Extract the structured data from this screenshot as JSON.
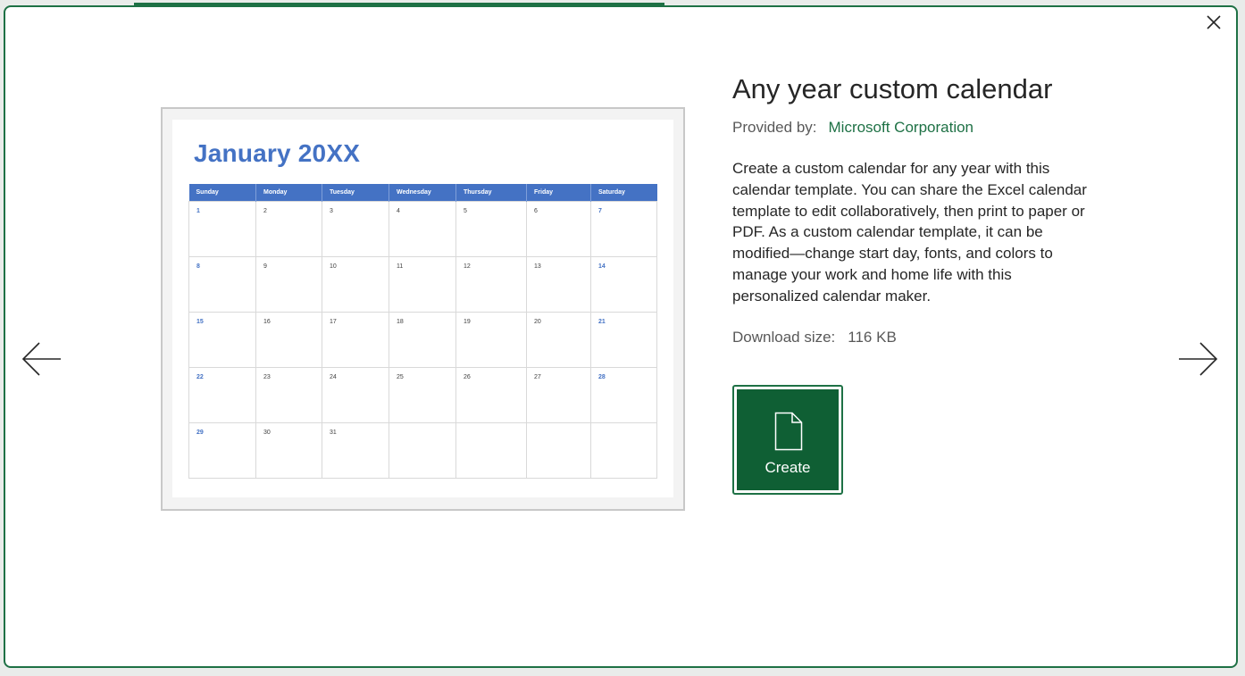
{
  "dialog": {
    "close_icon": "close-icon",
    "prev_icon": "arrow-left-icon",
    "next_icon": "arrow-right-icon",
    "accent_color": "#1e7145"
  },
  "template": {
    "title": "Any year custom calendar",
    "provided_by_label": "Provided by:",
    "provider": "Microsoft Corporation",
    "description": "Create a custom calendar for any year with this calendar template. You can share the Excel calendar template to edit collaboratively, then print to paper or PDF. As a custom calendar template, it can be modified—change start day, fonts, and colors to manage your work and home life with this personalized calendar maker.",
    "download_size_label": "Download size:",
    "download_size": "116 KB",
    "create_label": "Create",
    "create_icon": "document-icon"
  },
  "preview": {
    "month_title": "January 20XX",
    "header_color": "#4472c4",
    "days": [
      "Sunday",
      "Monday",
      "Tuesday",
      "Wednesday",
      "Thursday",
      "Friday",
      "Saturday"
    ],
    "weeks": [
      [
        "1",
        "2",
        "3",
        "4",
        "5",
        "6",
        "7"
      ],
      [
        "8",
        "9",
        "10",
        "11",
        "12",
        "13",
        "14"
      ],
      [
        "15",
        "16",
        "17",
        "18",
        "19",
        "20",
        "21"
      ],
      [
        "22",
        "23",
        "24",
        "25",
        "26",
        "27",
        "28"
      ],
      [
        "29",
        "30",
        "31",
        "",
        "",
        "",
        ""
      ]
    ]
  }
}
